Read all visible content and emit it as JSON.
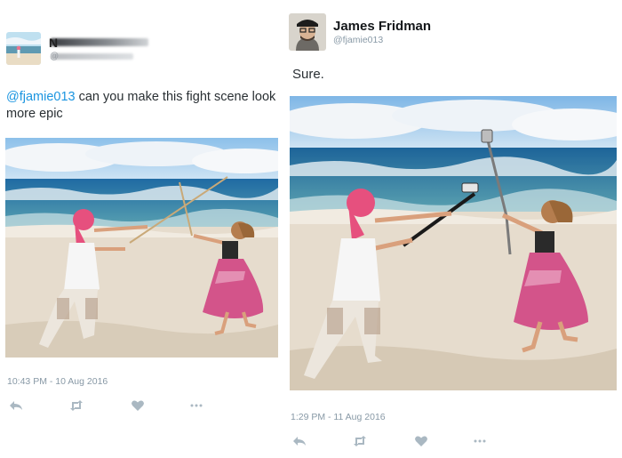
{
  "left_tweet": {
    "author_initial": "N",
    "handle_prefix": "@",
    "mention": "@fjamie013",
    "text": " can you make this fight scene look more epic",
    "timestamp": "10:43 PM - 10 Aug 2016",
    "actions": [
      "reply-icon",
      "retweet-icon",
      "like-icon",
      "more-icon"
    ]
  },
  "right_tweet": {
    "author_name": "James Fridman",
    "handle": "@fjamie013",
    "text": "Sure.",
    "timestamp": "1:29 PM - 11 Aug 2016",
    "actions": [
      "reply-icon",
      "retweet-icon",
      "like-icon",
      "more-icon"
    ]
  },
  "colors": {
    "mention": "#1b95e0",
    "meta_gray": "#8899a6",
    "icon_gray": "#aab8c2"
  }
}
